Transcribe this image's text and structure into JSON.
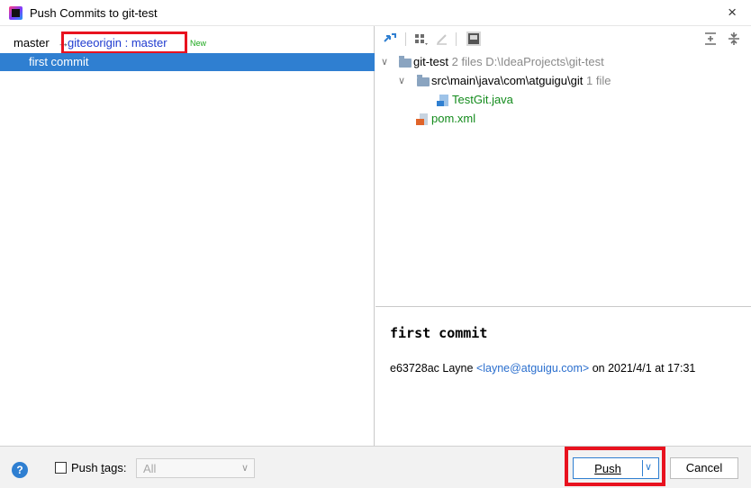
{
  "window": {
    "title": "Push Commits to git-test",
    "close_glyph": "×"
  },
  "left": {
    "local_branch": "master",
    "arrow": "→",
    "remote_branch": "giteeorigin : master",
    "new_badge": "New",
    "commit": "first commit"
  },
  "tree": {
    "root": {
      "name": "git-test",
      "meta": "2 files  D:\\IdeaProjects\\git-test"
    },
    "folder": {
      "name": "src\\main\\java\\com\\atguigu\\git",
      "meta": "1 file"
    },
    "file1": "TestGit.java",
    "file2": "pom.xml"
  },
  "details": {
    "title": "first commit",
    "hash_author": "e63728ac Layne",
    "email": "<layne@atguigu.com>",
    "date": "on 2021/4/1 at 17:31"
  },
  "footer": {
    "help": "?",
    "push_tags_prefix": "Push ",
    "push_tags_mnemonic": "t",
    "push_tags_suffix": "ags:",
    "tags_value": "All",
    "push_label": "Push",
    "cancel_label": "Cancel"
  },
  "colors": {
    "selection": "#2f7fd1",
    "highlight_box": "#e8121f",
    "new_badge": "#1da81d",
    "link": "#2b6fce"
  }
}
